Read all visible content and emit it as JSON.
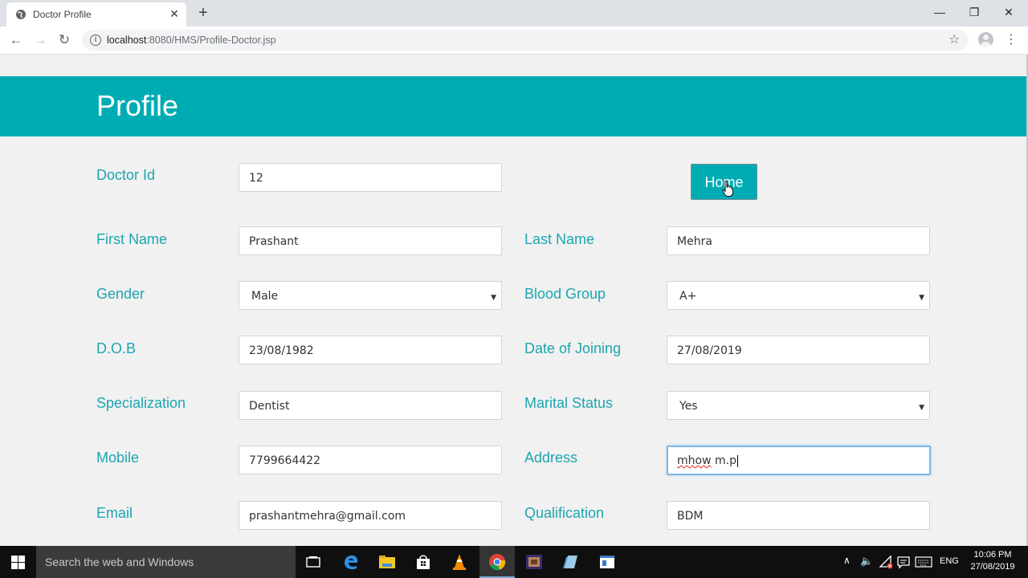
{
  "browser": {
    "tab_title": "Doctor Profile",
    "tab_close": "✕",
    "new_tab": "+",
    "url_host": "localhost",
    "url_path": ":8080/HMS/Profile-Doctor.jsp",
    "window_controls": {
      "minimize": "—",
      "restore": "❐",
      "close": "✕"
    }
  },
  "page": {
    "title": "Profile",
    "home_button": "Home",
    "fields": {
      "doctor_id": {
        "label": "Doctor Id",
        "value": "12"
      },
      "first_name": {
        "label": "First Name",
        "value": "Prashant"
      },
      "last_name": {
        "label": "Last Name",
        "value": "Mehra"
      },
      "gender": {
        "label": "Gender",
        "value": "Male"
      },
      "blood_group": {
        "label": "Blood Group",
        "value": "A+"
      },
      "dob": {
        "label": "D.O.B",
        "value": "23/08/1982"
      },
      "doj": {
        "label": "Date of Joining",
        "value": "27/08/2019"
      },
      "specialization": {
        "label": "Specialization",
        "value": "Dentist"
      },
      "marital_status": {
        "label": "Marital Status",
        "value": "Yes"
      },
      "mobile": {
        "label": "Mobile",
        "value": "7799664422"
      },
      "address": {
        "label": "Address",
        "value_word1": "mhow",
        "value_rest": " m.p"
      },
      "email": {
        "label": "Email",
        "value": "prashantmehra@gmail.com"
      },
      "qualification": {
        "label": "Qualification",
        "value": "BDM"
      }
    }
  },
  "taskbar": {
    "search_placeholder": "Search the web and Windows",
    "language": "ENG",
    "time": "10:06 PM",
    "date": "27/08/2019"
  },
  "colors": {
    "accent": "#00acb4",
    "label": "#1ca6b0"
  }
}
